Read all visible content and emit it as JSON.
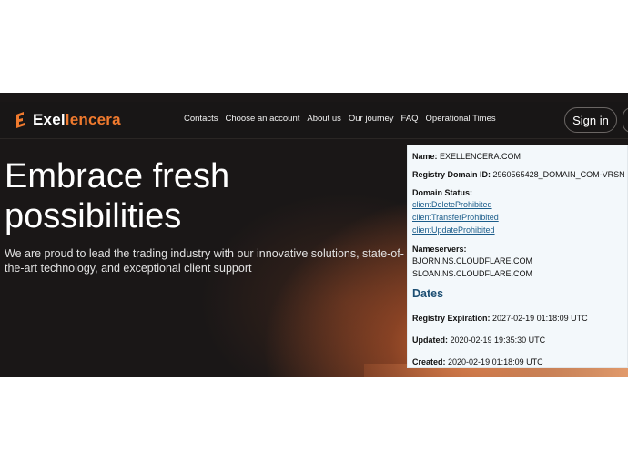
{
  "brand": {
    "name_prefix": "Exel",
    "name_accent": "lencera",
    "accent_color": "#f07a2e",
    "logo_icon": "flame-e-icon"
  },
  "nav": {
    "items": [
      "Contacts",
      "Choose an account",
      "About us",
      "Our journey",
      "FAQ",
      "Operational Times"
    ]
  },
  "header": {
    "signin_label": "Sign in"
  },
  "hero": {
    "headline": "Embrace fresh possibilities",
    "subtext": "We are proud to lead the trading industry with our innovative solutions, state-of-the-art technology, and exceptional client support"
  },
  "whois": {
    "name_label": "Name:",
    "name_value": "EXELLENCERA.COM",
    "registry_id_label": "Registry Domain ID:",
    "registry_id_value": "2960565428_DOMAIN_COM-VRSN",
    "status_label": "Domain Status:",
    "statuses": [
      "clientDeleteProhibited",
      "clientTransferProhibited",
      "clientUpdateProhibited"
    ],
    "nameservers_label": "Nameservers:",
    "nameservers": [
      "BJORN.NS.CLOUDFLARE.COM",
      "SLOAN.NS.CLOUDFLARE.COM"
    ],
    "dates_title": "Dates",
    "expiration_label": "Registry Expiration:",
    "expiration_value": "2027-02-19 01:18:09 UTC",
    "updated_label": "Updated:",
    "updated_value": "2020-02-19 19:35:30 UTC",
    "created_label": "Created:",
    "created_value": "2020-02-19 01:18:09 UTC"
  }
}
